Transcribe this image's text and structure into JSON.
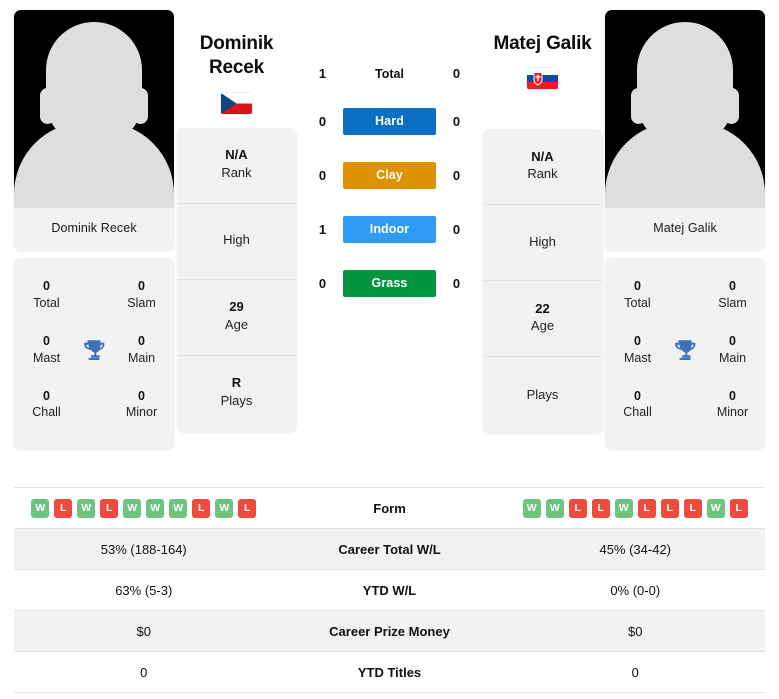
{
  "colors": {
    "hard": "#0b6fc4",
    "clay": "#dd9200",
    "indoor": "#2f9bf5",
    "grass": "#029640",
    "win": "#6cc47f",
    "loss": "#ef4a3c",
    "trophy": "#3c72b9"
  },
  "left_player": {
    "name_top": "Dominik\nRecek",
    "name_line1": "Dominik",
    "name_line2": "Recek",
    "photo_caption": "Dominik Recek",
    "flag": "czech-republic-flag",
    "info": [
      {
        "value": "N/A",
        "label": "Rank"
      },
      {
        "value": "",
        "label": "High"
      },
      {
        "value": "29",
        "label": "Age"
      },
      {
        "value": "R",
        "label": "Plays"
      }
    ],
    "titles": [
      {
        "value": "0",
        "label": "Total"
      },
      {
        "value": "0",
        "label": "Slam"
      },
      {
        "value": "0",
        "label": "Mast"
      },
      {
        "value": "0",
        "label": "Main"
      },
      {
        "value": "0",
        "label": "Chall"
      },
      {
        "value": "0",
        "label": "Minor"
      }
    ],
    "form": [
      "W",
      "L",
      "W",
      "L",
      "W",
      "W",
      "W",
      "L",
      "W",
      "L"
    ],
    "career_total_wl": "53% (188-164)",
    "ytd_wl": "63% (5-3)",
    "career_prize_money": "$0",
    "ytd_titles": "0"
  },
  "right_player": {
    "name_top": "Matej Galik",
    "name_line1": "Matej Galik",
    "name_line2": "",
    "photo_caption": "Matej Galik",
    "flag": "slovakia-flag",
    "info": [
      {
        "value": "N/A",
        "label": "Rank"
      },
      {
        "value": "",
        "label": "High"
      },
      {
        "value": "22",
        "label": "Age"
      },
      {
        "value": "",
        "label": "Plays"
      }
    ],
    "titles": [
      {
        "value": "0",
        "label": "Total"
      },
      {
        "value": "0",
        "label": "Slam"
      },
      {
        "value": "0",
        "label": "Mast"
      },
      {
        "value": "0",
        "label": "Main"
      },
      {
        "value": "0",
        "label": "Chall"
      },
      {
        "value": "0",
        "label": "Minor"
      }
    ],
    "form": [
      "W",
      "W",
      "L",
      "L",
      "W",
      "L",
      "L",
      "L",
      "W",
      "L"
    ],
    "career_total_wl": "45% (34-42)",
    "ytd_wl": "0% (0-0)",
    "career_prize_money": "$0",
    "ytd_titles": "0"
  },
  "h2h": [
    {
      "label": "Total",
      "left": "1",
      "right": "0",
      "badge": false,
      "color": ""
    },
    {
      "label": "Hard",
      "left": "0",
      "right": "0",
      "badge": true,
      "color": "#0b6fc4"
    },
    {
      "label": "Clay",
      "left": "0",
      "right": "0",
      "badge": true,
      "color": "#dd9200"
    },
    {
      "label": "Indoor",
      "left": "1",
      "right": "0",
      "badge": true,
      "color": "#2f9bf5"
    },
    {
      "label": "Grass",
      "left": "0",
      "right": "0",
      "badge": true,
      "color": "#029640"
    }
  ],
  "stats_rows": [
    {
      "label": "Form",
      "key": "form",
      "type": "form"
    },
    {
      "label": "Career Total W/L",
      "key": "career_total_wl",
      "type": "text"
    },
    {
      "label": "YTD W/L",
      "key": "ytd_wl",
      "type": "text"
    },
    {
      "label": "Career Prize Money",
      "key": "career_prize_money",
      "type": "text"
    },
    {
      "label": "YTD Titles",
      "key": "ytd_titles",
      "type": "text"
    }
  ]
}
